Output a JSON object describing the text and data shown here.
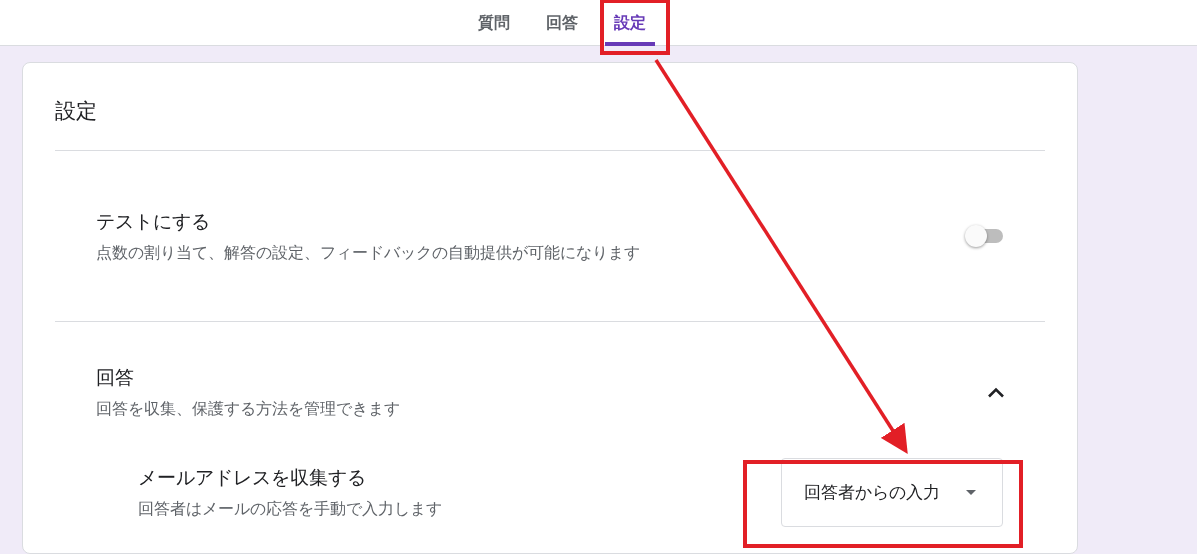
{
  "tabs": [
    {
      "label": "質問",
      "selected": false
    },
    {
      "label": "回答",
      "selected": false
    },
    {
      "label": "設定",
      "selected": true
    }
  ],
  "settings": {
    "title": "設定",
    "sections": [
      {
        "kind": "toggle",
        "title": "テストにする",
        "description": "点数の割り当て、解答の設定、フィードバックの自動提供が可能になります",
        "on": false
      },
      {
        "kind": "expandable",
        "title": "回答",
        "description": "回答を収集、保護する方法を管理できます",
        "expanded": true,
        "children": [
          {
            "kind": "dropdown",
            "title": "メールアドレスを収集する",
            "description": "回答者はメールの応答を手動で入力します",
            "value": "回答者からの入力"
          }
        ]
      }
    ]
  }
}
